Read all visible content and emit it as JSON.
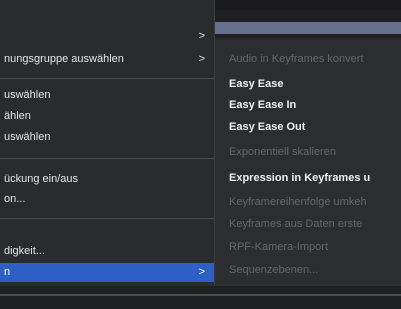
{
  "left_menu": {
    "items": [
      {
        "label": "",
        "has_submenu": true
      },
      {
        "label": "nungsgruppe auswählen",
        "has_submenu": true
      },
      {
        "label": "uswählen",
        "has_submenu": false
      },
      {
        "label": "ählen",
        "has_submenu": false
      },
      {
        "label": "uswählen",
        "has_submenu": false
      },
      {
        "label": "ückung ein/aus",
        "has_submenu": false
      },
      {
        "label": "on...",
        "has_submenu": false
      },
      {
        "label": "digkeit...",
        "has_submenu": false
      },
      {
        "label": "n",
        "has_submenu": true,
        "active": true
      }
    ],
    "chevron": ">"
  },
  "submenu": {
    "items": [
      {
        "label": "Audio in Keyframes konvert",
        "enabled": false
      },
      {
        "label": "Easy Ease",
        "enabled": true
      },
      {
        "label": "Easy Ease In",
        "enabled": true
      },
      {
        "label": "Easy Ease Out",
        "enabled": true
      },
      {
        "label": "Exponentiell skalieren",
        "enabled": false
      },
      {
        "label": "Expression in Keyframes u",
        "enabled": true
      },
      {
        "label": "Keyframereihenfolge umkeh",
        "enabled": false
      },
      {
        "label": "Keyframes aus Daten erste",
        "enabled": false
      },
      {
        "label": "RPF-Kamera-Import",
        "enabled": false
      },
      {
        "label": "Sequenzebenen...",
        "enabled": false
      }
    ]
  },
  "colors": {
    "menu_bg": "#2a2b2d",
    "highlight": "#2d5fc4",
    "disabled_text": "#66676b",
    "text": "#e6e6e6"
  }
}
